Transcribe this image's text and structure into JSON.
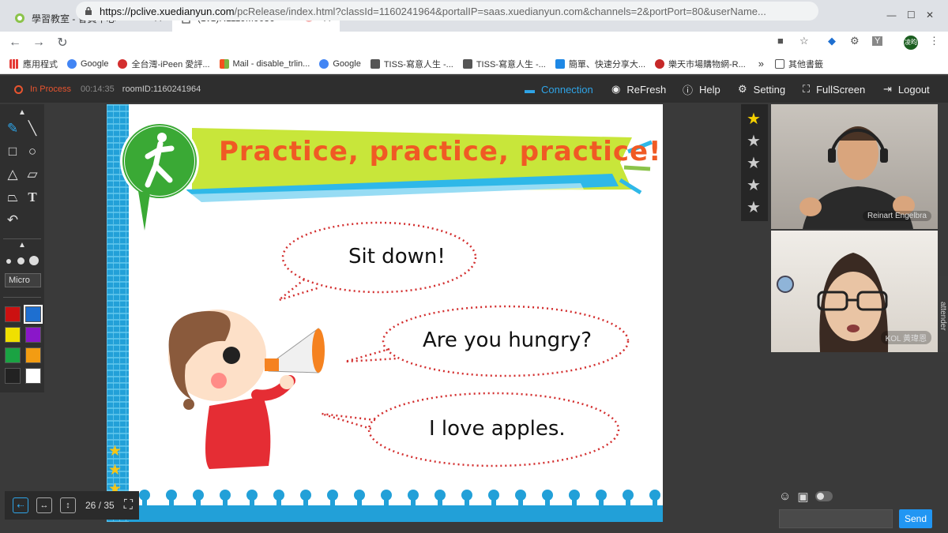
{
  "browser": {
    "tabs": [
      {
        "title": "學習教室 - 會員中心",
        "active": false
      },
      {
        "title": "(1v1)R1119M0036",
        "active": true
      }
    ],
    "url_host": "https://pclive.xuedianyun.com",
    "url_rest": "/pcRelease/index.html?classId=1160241964&portalIP=saas.xuedianyun.com&channels=2&portPort=80&userName...",
    "bookmarks": [
      {
        "label": "應用程式",
        "color": "#e53935"
      },
      {
        "label": "Google",
        "color": "#4285f4"
      },
      {
        "label": "全台灣-iPeen 愛評...",
        "color": "#d32f2f"
      },
      {
        "label": "Mail - disable_trlin...",
        "color": "#f4511e"
      },
      {
        "label": "Google",
        "color": "#4285f4"
      },
      {
        "label": "TISS-寫意人生 -...",
        "color": "#555555"
      },
      {
        "label": "TISS-寫意人生 -...",
        "color": "#555555"
      },
      {
        "label": "簡單、快速分享大...",
        "color": "#1e88e5"
      },
      {
        "label": "樂天市場購物網-R...",
        "color": "#c62828"
      }
    ],
    "other_bookmarks": "其他書籤",
    "overflow": "»",
    "profile": "凌昀"
  },
  "app": {
    "status": "In Process",
    "timer": "00:14:35",
    "room": "roomID:1160241964",
    "menu": {
      "connection": "Connection",
      "refresh": "ReFresh",
      "help": "Help",
      "setting": "Setting",
      "fullscreen": "FullScreen",
      "logout": "Logout"
    },
    "accent": "#2fa4e7",
    "status_color": "#e8542f"
  },
  "tools": {
    "font": "Micro",
    "colors": [
      "#cc1111",
      "#1e6fd0",
      "#f0e000",
      "#8a17c9",
      "#1aa343",
      "#f39c12",
      "#222222",
      "#ffffff"
    ]
  },
  "slide": {
    "title": "Practice, practice, practice!",
    "bubbles": [
      "Sit down!",
      "Are you hungry?",
      "I love apples."
    ],
    "page": "26 / 35"
  },
  "videos": {
    "teacher_name": "Reinart Engelbra",
    "student_name": "KOL 黃瑋恩",
    "attender_label": "attender"
  },
  "chat": {
    "send": "Send",
    "placeholder": ""
  }
}
